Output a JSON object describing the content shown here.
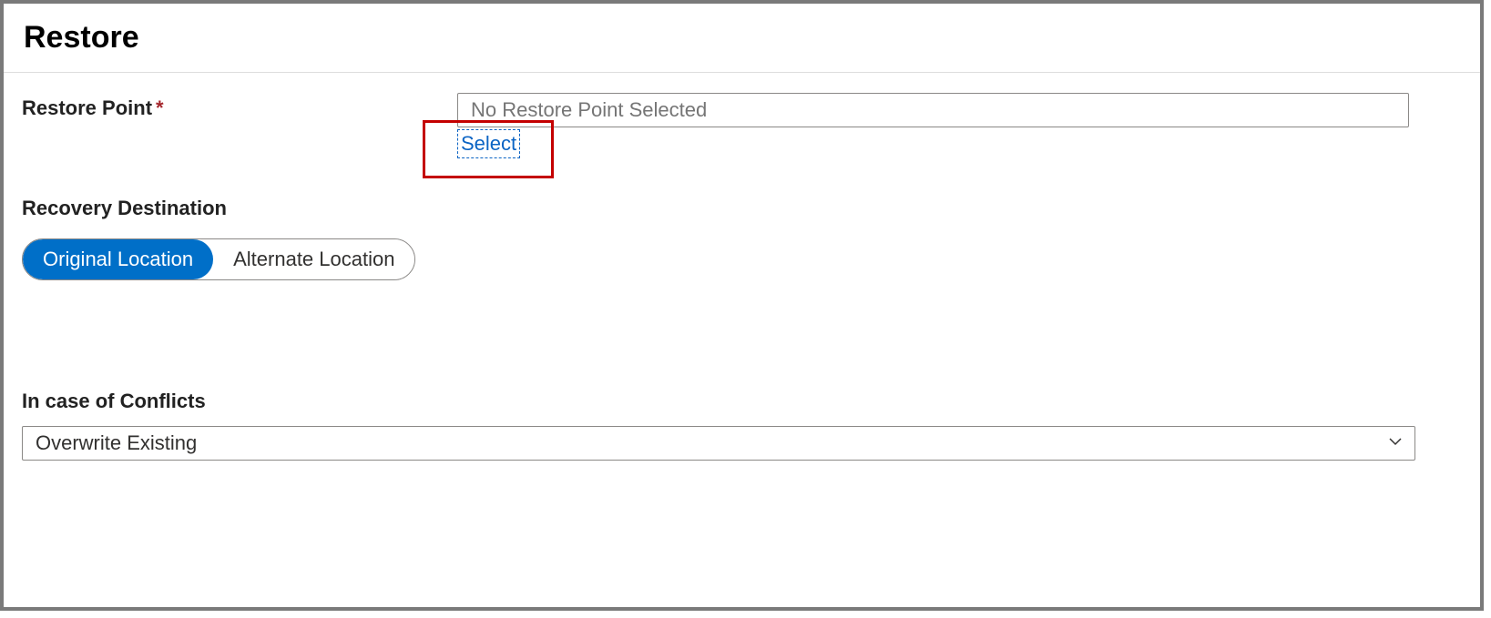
{
  "header": {
    "title": "Restore"
  },
  "restore_point": {
    "label": "Restore Point",
    "placeholder": "No Restore Point Selected",
    "select_link": "Select"
  },
  "recovery_destination": {
    "label": "Recovery Destination",
    "options": {
      "original": "Original Location",
      "alternate": "Alternate Location"
    },
    "selected": "original"
  },
  "conflicts": {
    "label": "In case of Conflicts",
    "value": "Overwrite Existing"
  }
}
